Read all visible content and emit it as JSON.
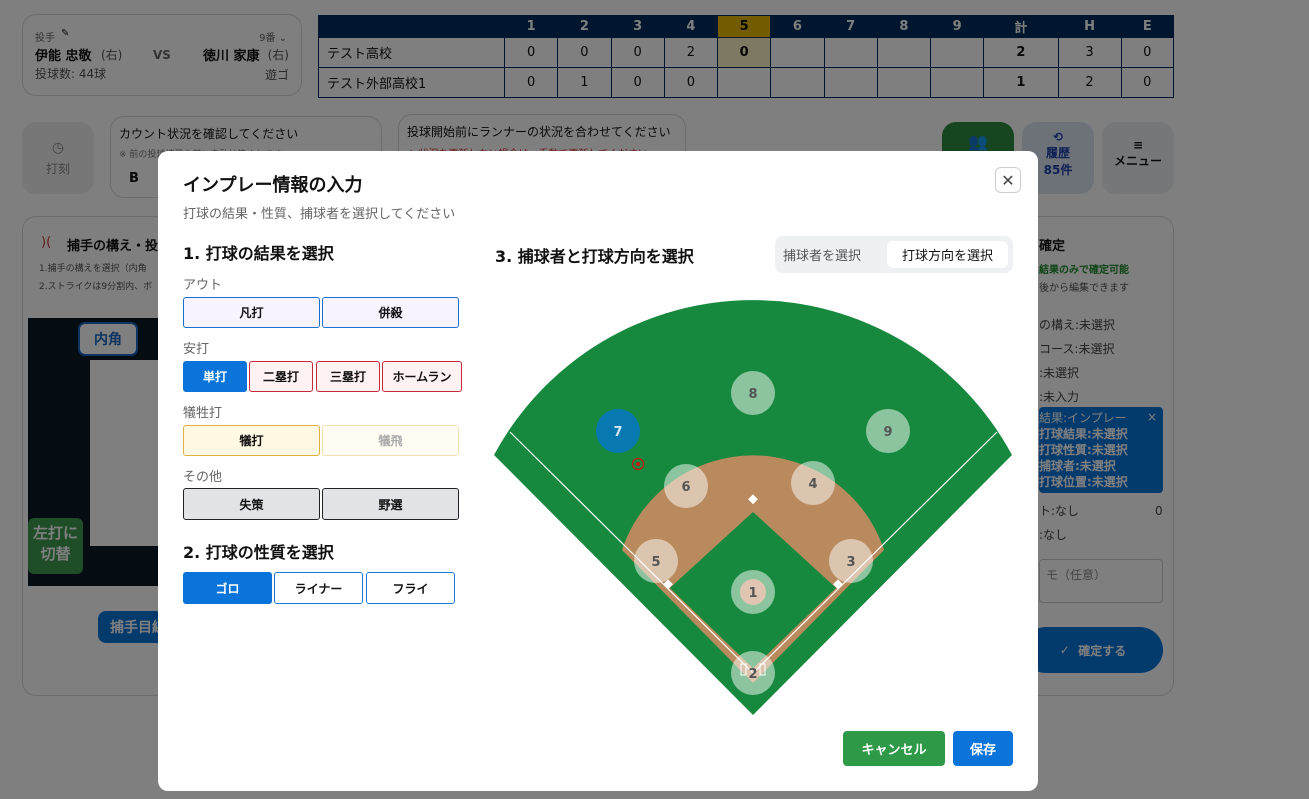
{
  "matchup": {
    "pitcher_label": "投手",
    "pitcher": "伊能 忠敬",
    "pitcher_hand": "(右)",
    "vs": "VS",
    "batter_order": "9番",
    "batter": "徳川 家康",
    "batter_hand": "(右)",
    "pitch_count": "投球数: 44球",
    "batter_result": "遊ゴ"
  },
  "scoreboard": {
    "headers": [
      "",
      "1",
      "2",
      "3",
      "4",
      "5",
      "6",
      "7",
      "8",
      "9",
      "計",
      "H",
      "E"
    ],
    "rows": [
      [
        "テスト高校",
        "0",
        "0",
        "0",
        "2",
        "0",
        "",
        "",
        "",
        "",
        "2",
        "3",
        "0"
      ],
      [
        "テスト外部高校1",
        "0",
        "1",
        "0",
        "0",
        "",
        "",
        "",
        "",
        "",
        "1",
        "2",
        "0"
      ]
    ]
  },
  "toolbar": {
    "stamp": "打刻",
    "count_title": "カウント状況を確認してください",
    "count_note": "※ 前の投球結果を基に自動計算されます",
    "count_b": "B",
    "runner_title": "投球開始前にランナーの状況を合わせてください",
    "runner_note": "※ 状況を更新しない場合は、手動で更新してください",
    "history_label": "履歴",
    "history_count": "85件",
    "menu": "メニュー"
  },
  "left_panel": {
    "title": "捕手の構え・投",
    "note1": "1.捕手の構えを選択（内角",
    "note2": "2.ストライクは9分割内、ボ",
    "inside": "内角",
    "switch": "左打に切替",
    "catcher_view": "捕手目線"
  },
  "right_panel": {
    "title": "確定",
    "green_note": "結果のみで確定可能",
    "note": "後から編集できます",
    "items": [
      "の構え:未選択",
      "コース:未選択",
      ":未選択",
      ":未入力"
    ],
    "active": {
      "title": "結果:インプレー",
      "lines": [
        "打球結果:未選択",
        "打球性質:未選択",
        "捕球者:未選択",
        "打球位置:未選択"
      ]
    },
    "items2": [
      "ト:なし",
      ":なし"
    ],
    "count": "0",
    "memo_placeholder": "モ（任意）",
    "confirm": "確定する"
  },
  "modal": {
    "title": "インプレー情報の入力",
    "subtitle": "打球の結果・性質、捕球者を選択してください",
    "section1": "1. 打球の結果を選択",
    "out_label": "アウト",
    "out": [
      "凡打",
      "併殺"
    ],
    "hit_label": "安打",
    "hits": [
      "単打",
      "二塁打",
      "三塁打",
      "ホームラン"
    ],
    "sac_label": "犠牲打",
    "sac": [
      "犠打",
      "犠飛"
    ],
    "other_label": "その他",
    "other": [
      "失策",
      "野選"
    ],
    "section2": "2. 打球の性質を選択",
    "nature": [
      "ゴロ",
      "ライナー",
      "フライ"
    ],
    "section3": "3. 捕球者と打球方向を選択",
    "mode_tabs": [
      "捕球者を選択",
      "打球方向を選択"
    ],
    "positions": [
      "1",
      "2",
      "3",
      "4",
      "5",
      "6",
      "7",
      "8",
      "9"
    ],
    "cancel": "キャンセル",
    "save": "保存"
  },
  "colors": {
    "primary": "#0a74da",
    "navy": "#002a5c",
    "green": "#17893f",
    "dirt": "#b98a5e",
    "selected": "#0a74da"
  }
}
